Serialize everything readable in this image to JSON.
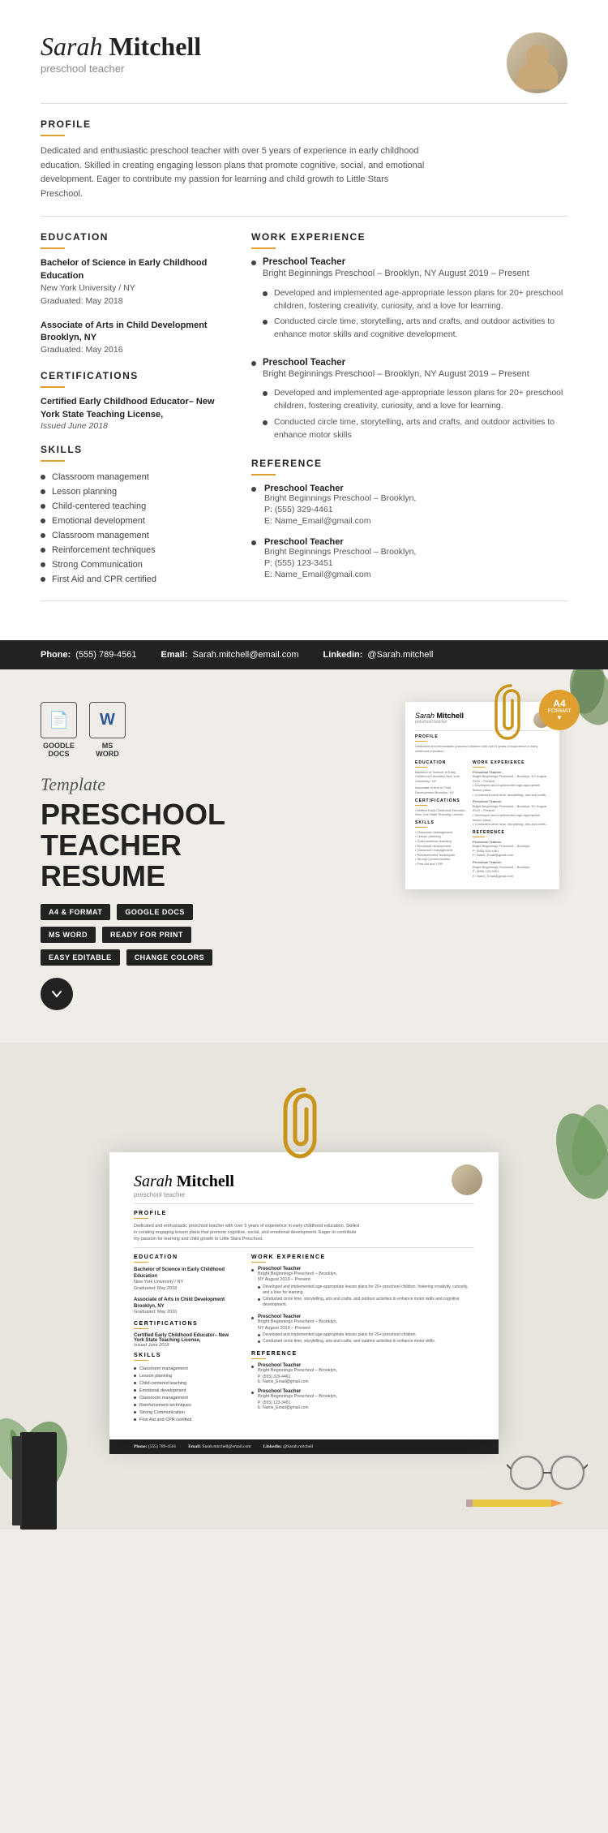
{
  "header": {
    "first_name": "Sarah",
    "last_name": "Mitchell",
    "title": "preschool teacher"
  },
  "profile": {
    "section_label": "PROFILE",
    "text": "Dedicated and enthusiastic preschool teacher with over 5 years of experience in early childhood education. Skilled in creating engaging lesson plans that promote cognitive, social, and emotional development. Eager to contribute my passion for learning and child growth to Little Stars Preschool."
  },
  "education": {
    "section_label": "EDUCATION",
    "items": [
      {
        "degree": "Bachelor of Science in Early Childhood Education",
        "school": "New York University / NY",
        "graduated": "Graduated: May 2018"
      },
      {
        "degree": "Associate of Arts in Child Development Brooklyn, NY",
        "school": "",
        "graduated": "Graduated: May 2016"
      }
    ]
  },
  "certifications": {
    "section_label": "CERTIFICATIONS",
    "text": "Certified Early Childhood Educator– New York State Teaching License,",
    "date": "Issued June 2018"
  },
  "skills": {
    "section_label": "SKILLS",
    "items": [
      "Classroom management",
      "Lesson planning",
      "Child-centered teaching",
      "Emotional development",
      "Classroom management",
      "Reinforcement techniques",
      "Strong Communication",
      "First Aid and CPR certified"
    ]
  },
  "work_experience": {
    "section_label": "WORK EXPERIENCE",
    "jobs": [
      {
        "title": "Preschool Teacher",
        "company": "Bright Beginnings Preschool – Brooklyn, NY August 2019 – Present",
        "duties": [
          "Developed and implemented age-appropriate lesson plans for 20+ preschool children, fostering creativity, curiosity, and a love for learning.",
          "Conducted circle time, storytelling, arts and crafts, and outdoor activities to enhance motor skills and cognitive development."
        ]
      },
      {
        "title": "Preschool Teacher",
        "company": "Bright Beginnings Preschool – Brooklyn, NY August 2019 – Present",
        "duties": [
          "Developed and implemented age-appropriate lesson plans for 20+ preschool children, fostering creativity, curiosity, and a love for learning.",
          "Conducted circle time, storytelling, arts and crafts, and outdoor activities to enhance motor skills"
        ]
      }
    ]
  },
  "reference": {
    "section_label": "REFERENCE",
    "refs": [
      {
        "title": "Preschool Teacher",
        "company": "Bright Beginnings Preschool – Brooklyn,",
        "phone": "P: (555) 329-4461",
        "email": "E: Name_Email@gmail.com"
      },
      {
        "title": "Preschool Teacher",
        "company": "Bright Beginnings Preschool – Brooklyn,",
        "phone": "P: (555) 123-3451",
        "email": "E: Name_Email@gmail.com"
      }
    ]
  },
  "footer": {
    "phone_label": "Phone:",
    "phone": "(555) 789-4561",
    "email_label": "Email:",
    "email": "Sarah.mitchell@email.com",
    "linkedin_label": "Linkedin:",
    "linkedin": "@Sarah.mitchell"
  },
  "showcase": {
    "tools": [
      {
        "icon": "📄",
        "label": "GOODLE\nDOCS"
      },
      {
        "icon": "W",
        "label": "MS\nWORD"
      }
    ],
    "template_label": "Template",
    "title_line1": "PRESCHOOL",
    "title_line2": "TEACHER",
    "title_line3": "RESUME",
    "badges": [
      {
        "text": "A4 & FORMAT",
        "style": "filled"
      },
      {
        "text": "GOOGLE DOCS",
        "style": "filled"
      },
      {
        "text": "MS WORD",
        "style": "filled"
      },
      {
        "text": "READY FOR PRINT",
        "style": "filled"
      },
      {
        "text": "EASY EDITABLE",
        "style": "filled"
      },
      {
        "text": "CHANGE COLORS",
        "style": "filled"
      }
    ],
    "a4_badge": "A4",
    "a4_sub": "FORMAT"
  }
}
